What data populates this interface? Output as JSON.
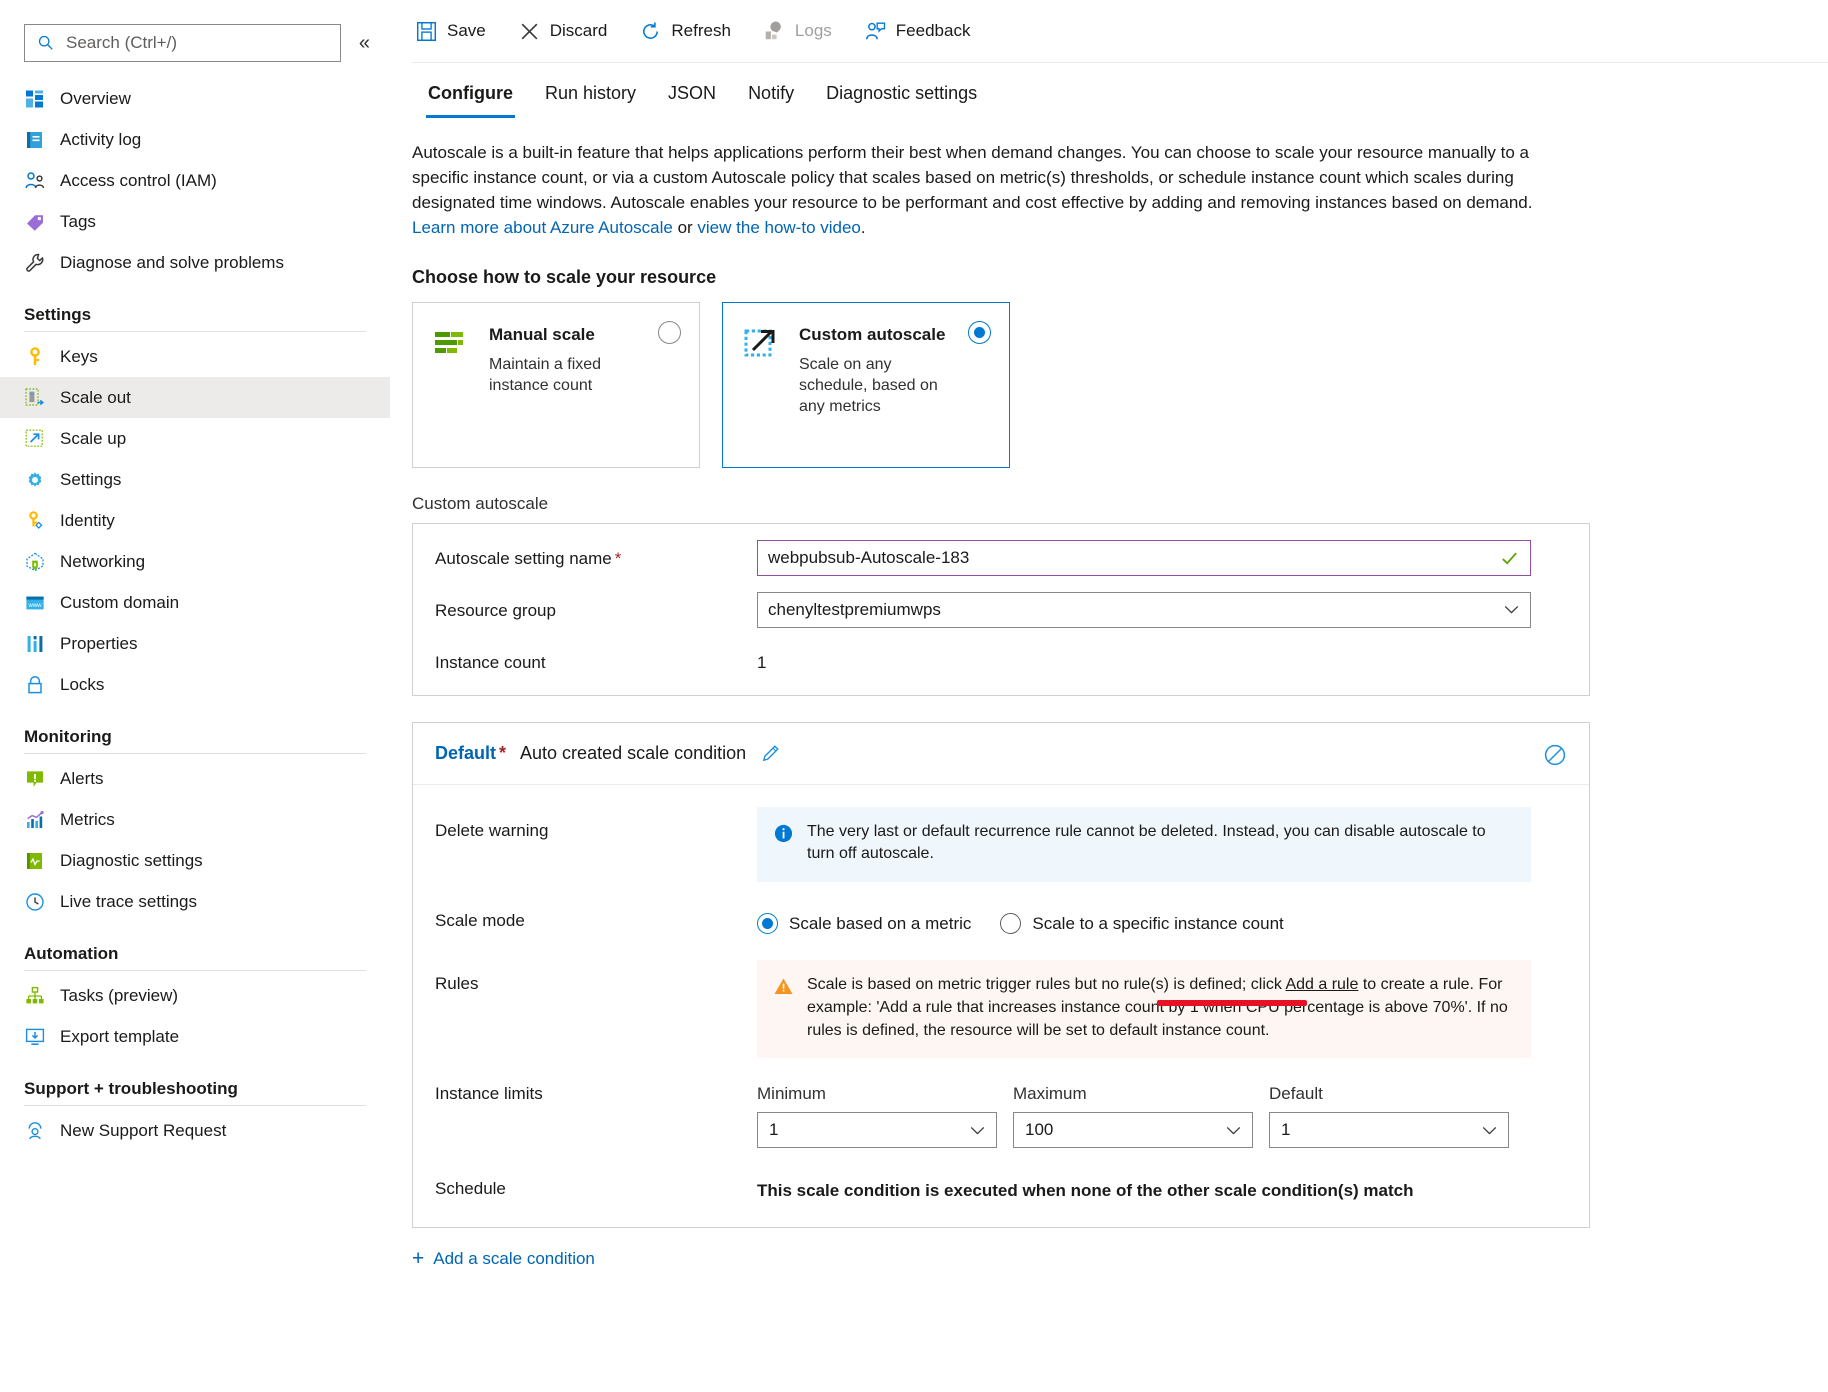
{
  "sidebar": {
    "search_placeholder": "Search (Ctrl+/)",
    "collapse_label": "«",
    "items": [
      {
        "label": "Overview",
        "icon": "overview-icon"
      },
      {
        "label": "Activity log",
        "icon": "activity-log-icon"
      },
      {
        "label": "Access control (IAM)",
        "icon": "access-control-icon"
      },
      {
        "label": "Tags",
        "icon": "tags-icon"
      },
      {
        "label": "Diagnose and solve problems",
        "icon": "wrench-icon"
      }
    ],
    "groups": [
      {
        "title": "Settings",
        "items": [
          {
            "label": "Keys",
            "icon": "key-icon"
          },
          {
            "label": "Scale out",
            "icon": "scale-out-icon",
            "selected": true
          },
          {
            "label": "Scale up",
            "icon": "scale-up-icon"
          },
          {
            "label": "Settings",
            "icon": "gear-icon"
          },
          {
            "label": "Identity",
            "icon": "identity-icon"
          },
          {
            "label": "Networking",
            "icon": "networking-icon"
          },
          {
            "label": "Custom domain",
            "icon": "custom-domain-icon"
          },
          {
            "label": "Properties",
            "icon": "properties-icon"
          },
          {
            "label": "Locks",
            "icon": "lock-icon"
          }
        ]
      },
      {
        "title": "Monitoring",
        "items": [
          {
            "label": "Alerts",
            "icon": "alerts-icon"
          },
          {
            "label": "Metrics",
            "icon": "metrics-icon"
          },
          {
            "label": "Diagnostic settings",
            "icon": "diagnostic-settings-icon"
          },
          {
            "label": "Live trace settings",
            "icon": "clock-icon"
          }
        ]
      },
      {
        "title": "Automation",
        "items": [
          {
            "label": "Tasks (preview)",
            "icon": "tasks-icon"
          },
          {
            "label": "Export template",
            "icon": "export-template-icon"
          }
        ]
      },
      {
        "title": "Support + troubleshooting",
        "items": [
          {
            "label": "New Support Request",
            "icon": "support-request-icon"
          }
        ]
      }
    ]
  },
  "toolbar": {
    "save_label": "Save",
    "discard_label": "Discard",
    "refresh_label": "Refresh",
    "logs_label": "Logs",
    "feedback_label": "Feedback"
  },
  "tabs": [
    {
      "label": "Configure",
      "active": true
    },
    {
      "label": "Run history",
      "active": false
    },
    {
      "label": "JSON",
      "active": false
    },
    {
      "label": "Notify",
      "active": false
    },
    {
      "label": "Diagnostic settings",
      "active": false
    }
  ],
  "intro": {
    "text_before": "Autoscale is a built-in feature that helps applications perform their best when demand changes. You can choose to scale your resource manually to a specific instance count, or via a custom Autoscale policy that scales based on metric(s) thresholds, or schedule instance count which scales during designated time windows. Autoscale enables your resource to be performant and cost effective by adding and removing instances based on demand. ",
    "link1": "Learn more about Azure Autoscale",
    "conjunction": " or ",
    "link2": "view the how-to video",
    "period": "."
  },
  "choose": {
    "heading": "Choose how to scale your resource",
    "cards": [
      {
        "title": "Manual scale",
        "desc": "Maintain a fixed instance count",
        "selected": false,
        "icon": "manual-scale-icon"
      },
      {
        "title": "Custom autoscale",
        "desc": "Scale on any schedule, based on any metrics",
        "selected": true,
        "icon": "custom-autoscale-icon"
      }
    ]
  },
  "custom_autoscale": {
    "section_label": "Custom autoscale",
    "setting_name_label": "Autoscale setting name",
    "setting_name_value": "webpubsub-Autoscale-183",
    "resource_group_label": "Resource group",
    "resource_group_value": "chenyltestpremiumwps",
    "instance_count_label": "Instance count",
    "instance_count_value": "1"
  },
  "condition": {
    "default_label": "Default",
    "name": "Auto created scale condition",
    "edit_icon": "pencil-icon",
    "disable_icon": "disable-icon",
    "delete_warning_label": "Delete warning",
    "delete_warning_text": "The very last or default recurrence rule cannot be deleted. Instead, you can disable autoscale to turn off autoscale.",
    "scale_mode_label": "Scale mode",
    "scale_mode_options": [
      {
        "label": "Scale based on a metric",
        "selected": true
      },
      {
        "label": "Scale to a specific instance count",
        "selected": false
      }
    ],
    "rules_label": "Rules",
    "rules_text_before": "Scale is based on metric trigger rules but no rule(s) is defined; click ",
    "rules_link": "Add a rule",
    "rules_text_after": " to create a rule. For example: 'Add a rule that increases instance count by 1 when CPU percentage is above 70%'. If no rules is defined, the resource will be set to default instance count.",
    "instance_limits_label": "Instance limits",
    "limits": [
      {
        "caption": "Minimum",
        "value": "1"
      },
      {
        "caption": "Maximum",
        "value": "100"
      },
      {
        "caption": "Default",
        "value": "1"
      }
    ],
    "schedule_label": "Schedule",
    "schedule_text": "This scale condition is executed when none of the other scale condition(s) match"
  },
  "add_scale_condition": "Add a scale condition",
  "colors": {
    "accent": "#0078d4",
    "link": "#0065b3",
    "required": "#a4262c",
    "input_focus_border": "#8f4f9e",
    "valid_check": "#57a300",
    "info_bg": "#eff6fc",
    "warn_bg": "#fdf6f3",
    "annotation_red": "#e81123",
    "selected_nav_bg": "#edebe9"
  }
}
